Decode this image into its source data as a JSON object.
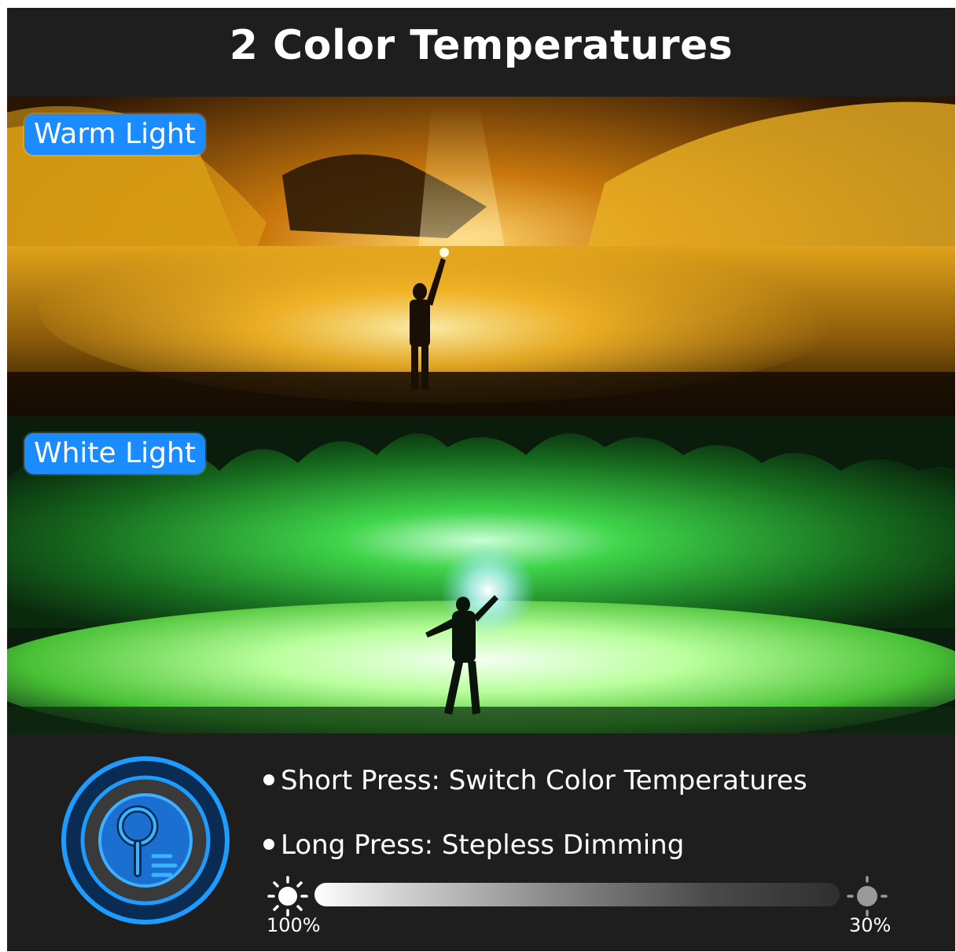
{
  "header": {
    "title": "2 Color Temperatures"
  },
  "panels": {
    "warm": {
      "label": "Warm Light"
    },
    "white": {
      "label": "White Light"
    }
  },
  "info": {
    "bullets": [
      "Short Press: Switch Color Temperatures",
      "Long Press: Stepless Dimming"
    ],
    "dimming": {
      "max_label": "100%",
      "min_label": "30%"
    }
  },
  "icons": {
    "button": "flashlight-button-icon",
    "bright": "sun-bright-icon",
    "dim": "sun-dim-icon"
  },
  "colors": {
    "background": "#1e1e1e",
    "tag_blue": "#1a8cff",
    "warm_glow": "#ffb81c",
    "white_glow": "#7dff6a",
    "icon_blue": "#1d9bff"
  }
}
